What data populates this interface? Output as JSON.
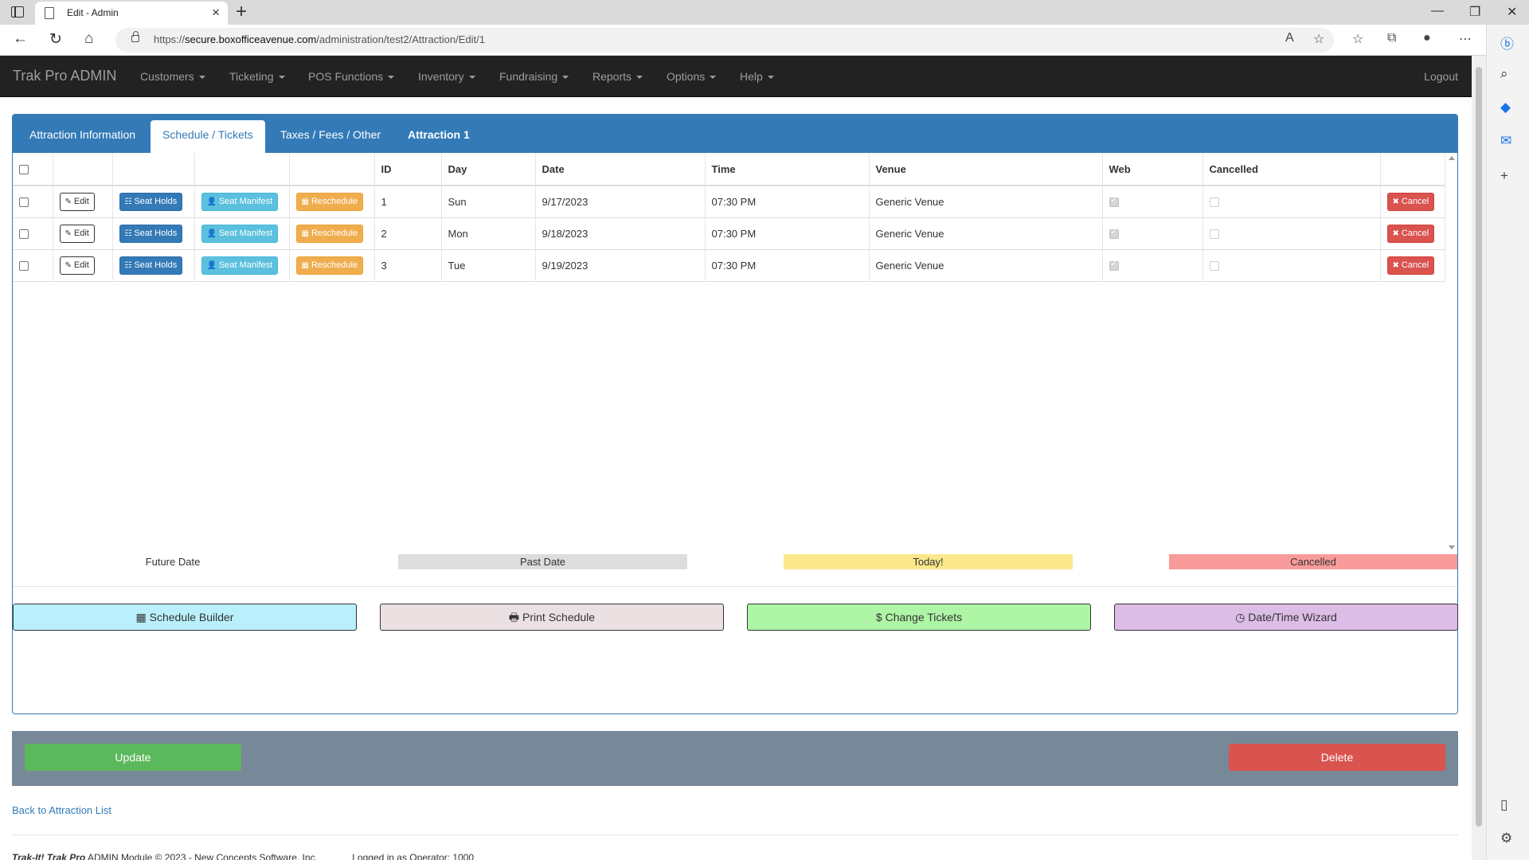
{
  "browser": {
    "tab_title": "Edit - Admin",
    "url_prefix": "https://",
    "url_host": "secure.boxofficeavenue.com",
    "url_path": "/administration/test2/Attraction/Edit/1"
  },
  "navbar": {
    "brand": "Trak Pro ADMIN",
    "menus": [
      "Customers",
      "Ticketing",
      "POS Functions",
      "Inventory",
      "Fundraising",
      "Reports",
      "Options",
      "Help"
    ],
    "logout": "Logout"
  },
  "tabs": {
    "attraction_info": "Attraction Information",
    "schedule": "Schedule / Tickets",
    "taxes": "Taxes / Fees / Other",
    "attraction_name": "Attraction 1"
  },
  "grid": {
    "headers": {
      "id": "ID",
      "day": "Day",
      "date": "Date",
      "time": "Time",
      "venue": "Venue",
      "web": "Web",
      "cancelled": "Cancelled"
    },
    "buttons": {
      "edit": "Edit",
      "holds": "Seat Holds",
      "manifest": "Seat Manifest",
      "reschedule": "Reschedule",
      "cancel": "Cancel"
    },
    "rows": [
      {
        "id": "1",
        "day": "Sun",
        "date": "9/17/2023",
        "time": "07:30 PM",
        "venue": "Generic Venue",
        "web": true,
        "cancelled": false
      },
      {
        "id": "2",
        "day": "Mon",
        "date": "9/18/2023",
        "time": "07:30 PM",
        "venue": "Generic Venue",
        "web": true,
        "cancelled": false
      },
      {
        "id": "3",
        "day": "Tue",
        "date": "9/19/2023",
        "time": "07:30 PM",
        "venue": "Generic Venue",
        "web": true,
        "cancelled": false
      }
    ]
  },
  "legend": {
    "future": "Future Date",
    "past": "Past Date",
    "today": "Today!",
    "cancelled": "Cancelled",
    "colors": {
      "past": "#dddddd",
      "today": "#fbe88b",
      "cancelled": "#fa9b9b"
    }
  },
  "actions": {
    "schedule_builder": "Schedule Builder",
    "print_schedule": "Print Schedule",
    "change_tickets": "Change Tickets",
    "datetime_wizard": "Date/Time Wizard",
    "colors": {
      "schedule_builder": "#b9f0fb",
      "print_schedule": "#ebe1e3",
      "change_tickets": "#aef5a6",
      "datetime_wizard": "#dcbde6"
    }
  },
  "footer": {
    "update": "Update",
    "delete": "Delete",
    "back_link": "Back to Attraction List",
    "copyright_brand": "Trak-It! Trak Pro",
    "copyright_text": "ADMIN Module © 2023 - New Concepts Software, Inc.",
    "logged_in": "Logged in as Operator: 1000"
  }
}
